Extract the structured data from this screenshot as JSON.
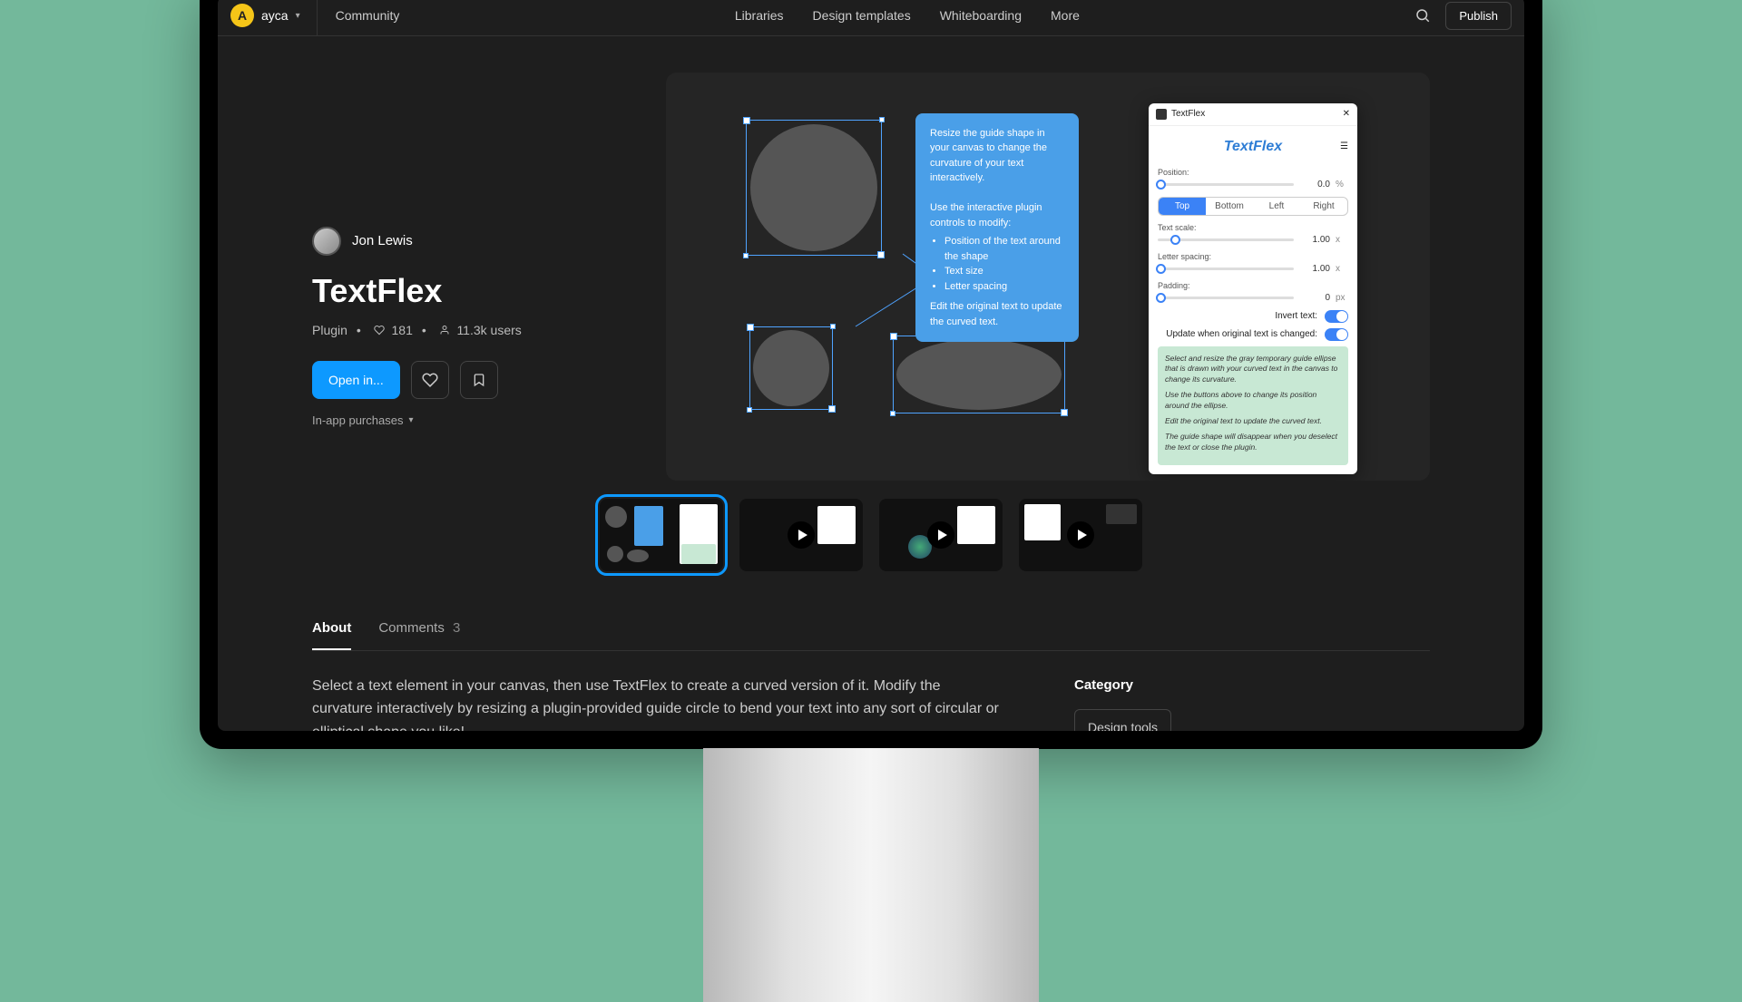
{
  "user": {
    "initial": "A",
    "name": "ayca"
  },
  "nav": {
    "community": "Community",
    "items": [
      "Libraries",
      "Design templates",
      "Whiteboarding",
      "More"
    ],
    "publish": "Publish"
  },
  "author": {
    "name": "Jon Lewis"
  },
  "title": "TextFlex",
  "meta": {
    "type": "Plugin",
    "likes": "181",
    "users": "11.3k users"
  },
  "actions": {
    "open": "Open in...",
    "iap": "In-app purchases"
  },
  "hero": {
    "note1": "Resize the guide shape in your canvas to change the curvature of your text interactively.",
    "note2_lead": "Use the interactive plugin controls to modify:",
    "note2_items": [
      "Position of the text around the shape",
      "Text size",
      "Letter spacing"
    ],
    "note3": "Edit the original text to update the curved text."
  },
  "plugin": {
    "brand": "TextFlex",
    "position_label": "Position:",
    "position_val": "0.0",
    "position_unit": "%",
    "tabs": [
      "Top",
      "Bottom",
      "Left",
      "Right"
    ],
    "scale_label": "Text scale:",
    "scale_val": "1.00",
    "scale_unit": "x",
    "spacing_label": "Letter spacing:",
    "spacing_val": "1.00",
    "spacing_unit": "x",
    "padding_label": "Padding:",
    "padding_val": "0",
    "padding_unit": "px",
    "invert": "Invert text:",
    "update": "Update when original text is changed:",
    "tip1": "Select and resize the gray temporary guide ellipse that is drawn with your curved text in the canvas to change its curvature.",
    "tip2": "Use the buttons above to change its position around the ellipse.",
    "tip3": "Edit the original text to update the curved text.",
    "tip4": "The guide shape will disappear when you deselect the text or close the plugin."
  },
  "tabs": {
    "about": "About",
    "comments": "Comments",
    "comments_count": "3"
  },
  "desc": "Select a text element in your canvas, then use TextFlex to create a curved version of it. Modify the curvature interactively by resizing a plugin-provided guide circle to bend your text into any sort of circular or elliptical shape you like!",
  "category": {
    "label": "Category",
    "tag": "Design tools"
  }
}
